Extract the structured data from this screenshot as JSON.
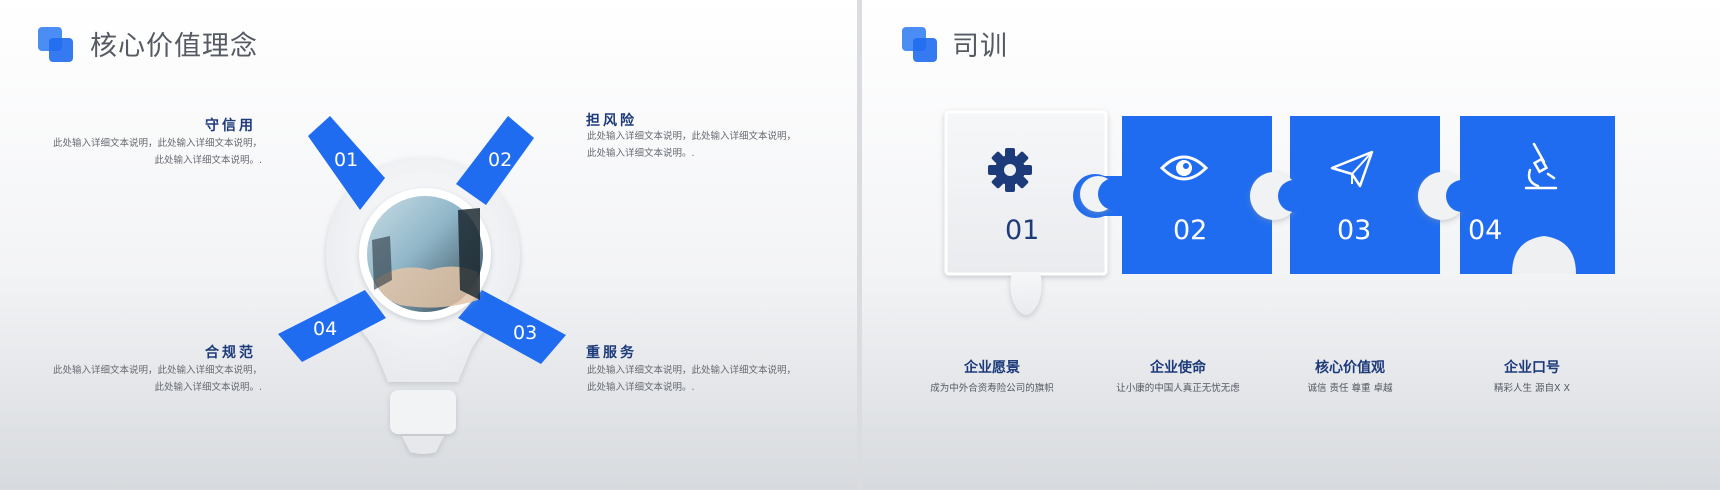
{
  "left": {
    "title": "核心价值理念",
    "items": [
      {
        "num": "01",
        "title": "守信用",
        "desc1": "此处输入详细文本说明，此处输入详细文本说明，",
        "desc2": "此处输入详细文本说明。."
      },
      {
        "num": "02",
        "title": "担风险",
        "desc1": "此处输入详细文本说明，此处输入详细文本说明，",
        "desc2": "此处输入详细文本说明。."
      },
      {
        "num": "03",
        "title": "重服务",
        "desc1": "此处输入详细文本说明，此处输入详细文本说明，",
        "desc2": "此处输入详细文本说明。."
      },
      {
        "num": "04",
        "title": "合规范",
        "desc1": "此处输入详细文本说明，此处输入详细文本说明，",
        "desc2": "此处输入详细文本说明。."
      }
    ]
  },
  "right": {
    "title": "司训",
    "pieces": [
      {
        "num": "01",
        "icon": "gear-icon",
        "title": "企业愿景",
        "desc": "成为中外合资寿险公司的旗帜"
      },
      {
        "num": "02",
        "icon": "eye-icon",
        "title": "企业使命",
        "desc": "让小康的中国人真正无忧无虑"
      },
      {
        "num": "03",
        "icon": "paper-plane-icon",
        "title": "核心价值观",
        "desc": "诚信    责任    尊重    卓越"
      },
      {
        "num": "04",
        "icon": "microscope-icon",
        "title": "企业口号",
        "desc": "精彩人生    源自X X"
      }
    ]
  },
  "colors": {
    "accent": "#1f6cf0",
    "navy": "#1d3b7a",
    "light_blue": "#4a8ef5"
  }
}
